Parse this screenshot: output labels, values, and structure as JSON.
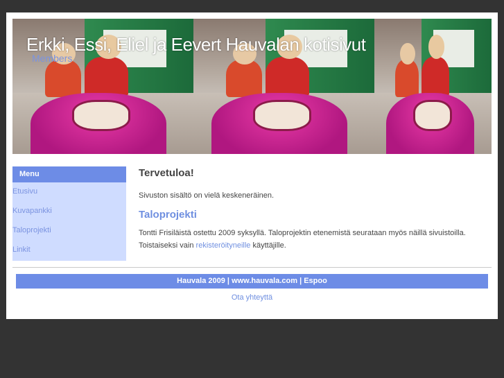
{
  "header": {
    "title": "Erkki, Essi, Eliel ja Eevert Hauvalan kotisivut",
    "subtitle": "Members"
  },
  "menu": {
    "heading": "Menu",
    "items": [
      {
        "label": "Etusivu"
      },
      {
        "label": "Kuvapankki"
      },
      {
        "label": "Taloprojekti"
      },
      {
        "label": "Linkit"
      }
    ]
  },
  "content": {
    "welcome_heading": "Tervetuloa!",
    "welcome_text": "Sivuston sisältö on vielä keskeneräinen.",
    "project_heading": "Taloprojekti",
    "project_text_before": "Tontti Frisiläistä ostettu 2009 syksyllä. Taloprojektin etenemistä seurataan myös näillä sivuistoilla. Toistaiseksi vain ",
    "project_link": "rekisteröityneille",
    "project_text_after": " käyttäjille."
  },
  "footer": {
    "text": "Hauvala 2009 | www.hauvala.com | Espoo",
    "contact": "Ota yhteyttä"
  }
}
